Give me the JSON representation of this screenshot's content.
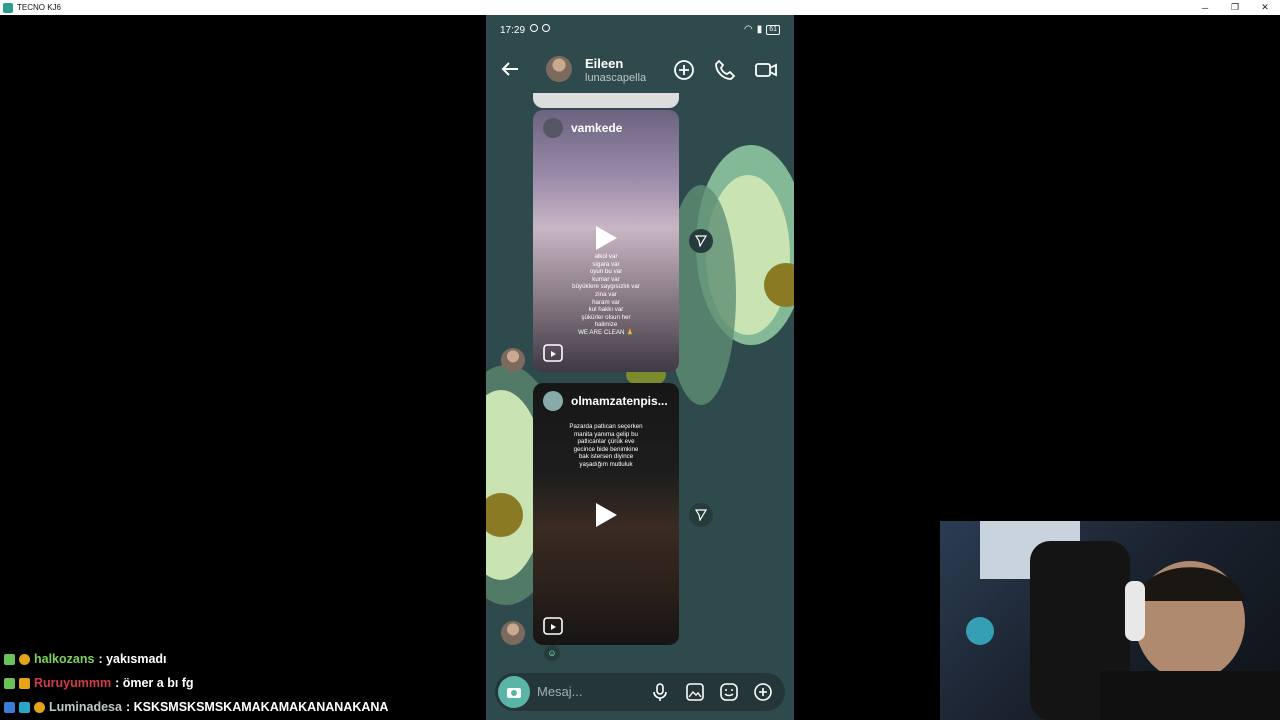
{
  "window": {
    "title": "TECNO KJ6",
    "controls": [
      "minimize",
      "restore",
      "close"
    ]
  },
  "status_bar": {
    "time": "17:29",
    "battery": "61"
  },
  "header": {
    "name": "Eileen",
    "username": "lunascapella"
  },
  "messages": [
    {
      "type": "reel",
      "user": "vamkede",
      "caption": [
        "alkol var",
        "sigara var",
        "oyun bu var",
        "kumar var",
        "büyüklere saygısızlık var",
        "zina var",
        "haram var",
        "kul hakkı var",
        "şükürler olsun her",
        "halimize",
        "WE ARE CLEAN 🙏"
      ]
    },
    {
      "type": "reel",
      "user": "olmamzatenpis...",
      "caption": [
        "Pazarda patlıcan seçerken",
        "manita yanıma gelip bu",
        "patlıcanlar çürük eve",
        "gecince bide benimkine",
        "bak istersen diyince",
        "yaşadığım mutluluk"
      ]
    }
  ],
  "composer": {
    "placeholder": "Mesaj..."
  },
  "chat": [
    {
      "user": "halkozans",
      "message": ": yakısmadı",
      "color": "#7bd35a"
    },
    {
      "user": "Ruruyummm",
      "message": ": ömer a bı fg",
      "color": "#d23b4a"
    },
    {
      "user": "Luminadesa",
      "message": ": KSKSMSKSMSKAMAKAMAKANANAKANA",
      "color": "#bfc7c9"
    }
  ],
  "colors": {
    "phone_bg": "#2f4a4c",
    "accent": "#5ab5a7"
  }
}
